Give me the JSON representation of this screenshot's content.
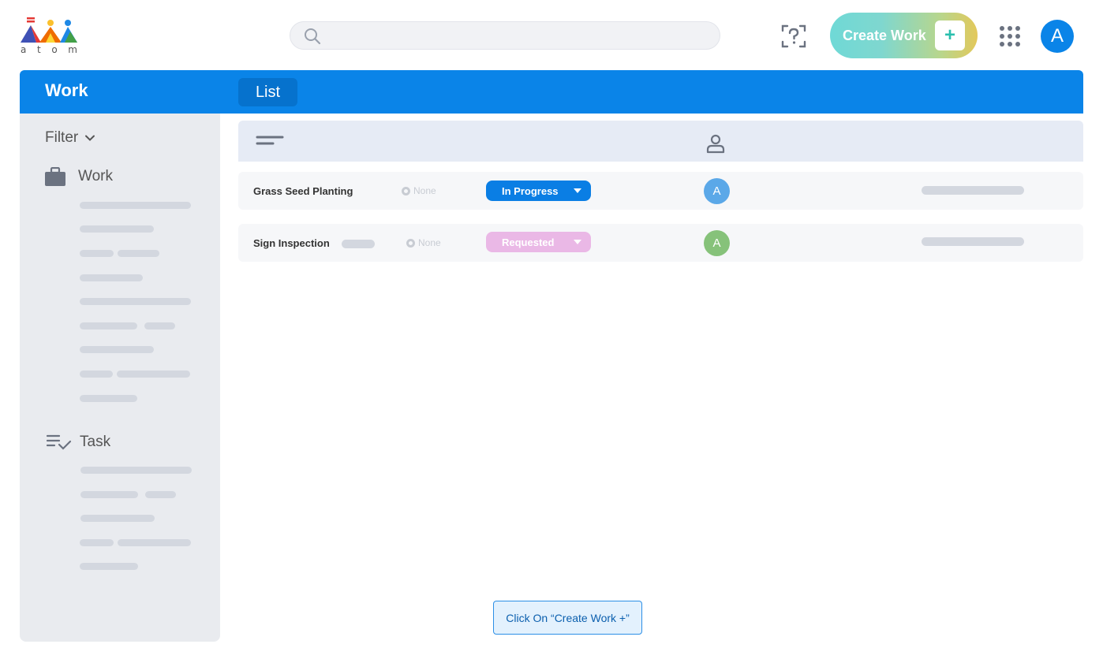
{
  "app": {
    "logo_letters": [
      "a",
      "t",
      "o",
      "m"
    ]
  },
  "topbar": {
    "search_placeholder": "",
    "create_label": "Create Work",
    "create_plus": "+",
    "avatar_initial": "A"
  },
  "header": {
    "title": "Work",
    "tab_list": "List"
  },
  "sidebar": {
    "filter_label": "Filter",
    "sections": [
      {
        "label": "Work",
        "icon": "briefcase-icon"
      },
      {
        "label": "Task",
        "icon": "checklist-icon"
      }
    ]
  },
  "table": {
    "rows": [
      {
        "name": "Grass Seed Planting",
        "priority": "None",
        "status": "In Progress",
        "status_color": "#0a7ee4",
        "assignee": "A",
        "assignee_color": "#5ba8e8"
      },
      {
        "name": "Sign Inspection",
        "priority": "None",
        "status": "Requested",
        "status_color": "#eab8e6",
        "assignee": "A",
        "assignee_color": "#86c27a"
      }
    ]
  },
  "tooltip": {
    "text": "Click On “Create Work +”"
  },
  "colors": {
    "brand_blue": "#0a84e8",
    "sidebar_bg": "#e9ebef",
    "table_header_bg": "#e6ebf5"
  }
}
